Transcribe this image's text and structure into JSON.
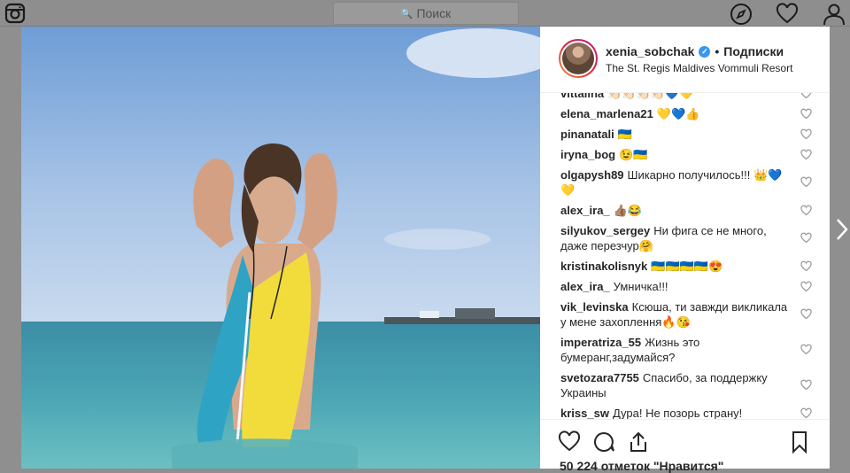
{
  "topbar": {
    "search_placeholder": "Поиск",
    "logo_icon": "instagram-icon",
    "nav_icons": [
      "explore-icon",
      "heart-icon",
      "profile-icon"
    ]
  },
  "post": {
    "username": "xenia_sobchak",
    "verified": true,
    "dot": "•",
    "follow_label": "Подписки",
    "location": "The St. Regis Maldives Vommuli Resort",
    "likes_text": "50 224 отметок \"Нравится\""
  },
  "comments": [
    {
      "user": "vittalina",
      "text": "👏🏻👏🏻👏🏻👏🏻💙💛"
    },
    {
      "user": "elena_marlena21",
      "text": "💛💙👍"
    },
    {
      "user": "pinanatali",
      "text": "🇺🇦"
    },
    {
      "user": "iryna_bog",
      "text": "😉🇺🇦"
    },
    {
      "user": "olgapysh89",
      "text": "Шикарно получилось!!! 👑💙💛"
    },
    {
      "user": "alex_ira_",
      "text": "👍🏽😂"
    },
    {
      "user": "silyukov_sergey",
      "text": "Ни фига се не много, даже перезчур🤗"
    },
    {
      "user": "kristinakolisnyk",
      "text": "🇺🇦🇺🇦🇺🇦🇺🇦😍"
    },
    {
      "user": "alex_ira_",
      "text": "Умничка!!!"
    },
    {
      "user": "vik_levinska",
      "text": "Ксюша, ти завжди викликала у мене захоплення🔥😘"
    },
    {
      "user": "imperatriza_55",
      "text": "Жизнь это бумеранг,задумайся?"
    },
    {
      "user": "svetozara7755",
      "text": "Спасибо, за поддержку Украины"
    },
    {
      "user": "kriss_sw",
      "text": "Дура! Не позорь страну!"
    }
  ],
  "colors": {
    "accent": "#3897f0",
    "text": "#262626",
    "overlay": "#8f8f8f",
    "swimsuit_blue": "#2fa3c4",
    "swimsuit_yellow": "#f2dc3c"
  }
}
